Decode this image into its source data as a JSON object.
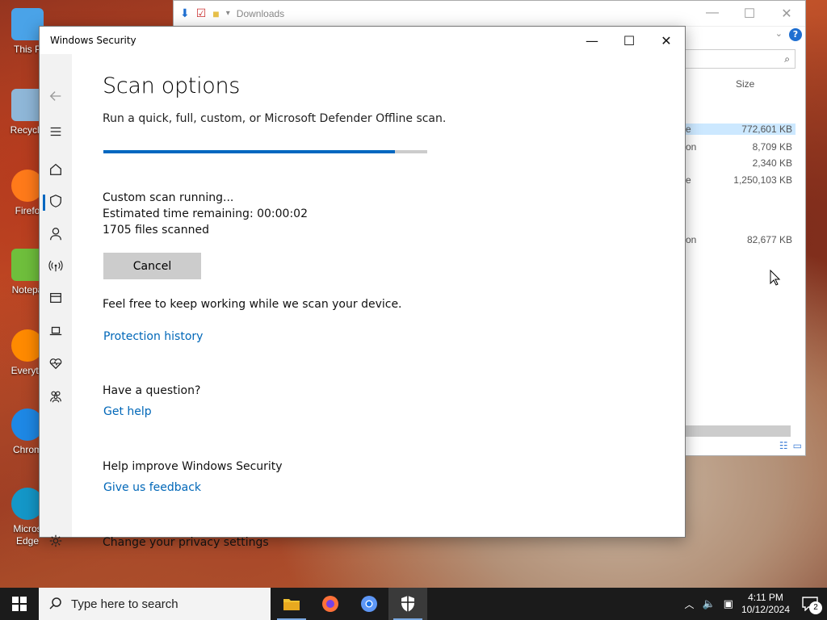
{
  "desktop": {
    "icons": [
      {
        "label": "This P",
        "color": "#4aa3e8"
      },
      {
        "label": "Recycle",
        "color": "#8fb7d8"
      },
      {
        "label": "Firefo",
        "color": "#ff7a1a"
      },
      {
        "label": "Notepa",
        "color": "#6fbf3c"
      },
      {
        "label": "Everyth",
        "color": "#ff8a00"
      },
      {
        "label": "Chrom",
        "color": "#1e88e5"
      },
      {
        "label": "Micros Edge",
        "color": "#1497c8"
      }
    ]
  },
  "explorer": {
    "title": "Downloads",
    "column_size": "Size",
    "sizes": [
      "772,601 KB",
      "8,709 KB",
      "2,340 KB",
      "1,250,103 KB",
      "82,677 KB"
    ],
    "name_fragments": [
      "e",
      "on",
      "e",
      "on"
    ]
  },
  "security": {
    "title": "Windows Security",
    "heading": "Scan options",
    "subtitle": "Run a quick, full, custom, or Microsoft Defender Offline scan.",
    "progress_pct": 90,
    "status_line1": "Custom scan running...",
    "status_line2": "Estimated time remaining:  00:00:02",
    "status_line3": "1705  files scanned",
    "cancel_label": "Cancel",
    "keep_working": "Feel free to keep working while we scan your device.",
    "protection_history": "Protection history",
    "question_heading": "Have a question?",
    "get_help": "Get help",
    "improve_heading": "Help improve Windows Security",
    "feedback": "Give us feedback",
    "privacy_heading": "Change your privacy settings",
    "accent": "#0067c0"
  },
  "taskbar": {
    "search_placeholder": "Type here to search",
    "time": "4:11 PM",
    "date": "10/12/2024",
    "notification_count": "2"
  }
}
